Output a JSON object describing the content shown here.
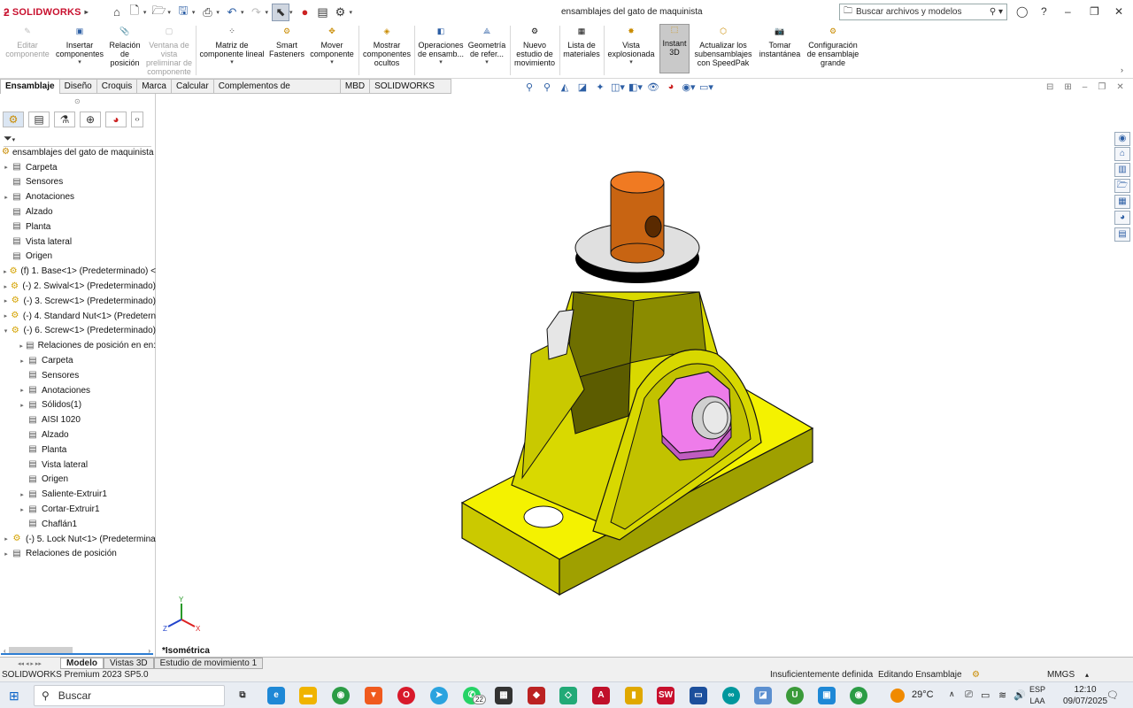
{
  "app": {
    "brand": "SOLIDWORKS",
    "document_title": "ensamblajes del gato de maquinista",
    "search_placeholder": "Buscar archivos y modelos"
  },
  "ribbon": [
    {
      "label": "Editar componente",
      "disabled": true
    },
    {
      "label": "Insertar componentes",
      "dropdown": true
    },
    {
      "label": "Relación de posición"
    },
    {
      "label": "Ventana de vista preliminar de componente",
      "disabled": true
    },
    {
      "label": "Matriz de componente lineal",
      "dropdown": true
    },
    {
      "label": "Smart Fasteners"
    },
    {
      "label": "Mover componente",
      "dropdown": true
    },
    {
      "label": "Mostrar componentes ocultos"
    },
    {
      "label": "Operaciones de ensamb...",
      "dropdown": true
    },
    {
      "label": "Geometría de refer...",
      "dropdown": true
    },
    {
      "label": "Nuevo estudio de movimiento"
    },
    {
      "label": "Lista de materiales"
    },
    {
      "label": "Vista explosionada",
      "dropdown": true
    },
    {
      "label": "Instant 3D",
      "active": true
    },
    {
      "label": "Actualizar los subensamblajes con SpeedPak"
    },
    {
      "label": "Tomar instantánea"
    },
    {
      "label": "Configuración de ensamblaje grande"
    }
  ],
  "tabs": [
    "Ensamblaje",
    "Diseño",
    "Croquis",
    "Marca",
    "Calcular",
    "Complementos de SOLIDWORKS",
    "MBD",
    "SOLIDWORKS CAM"
  ],
  "tree": [
    {
      "label": "ensamblajes del gato de maquinista (P",
      "indent": 0,
      "arrow": "",
      "icon": "asm"
    },
    {
      "label": "Carpeta",
      "indent": 0,
      "arrow": "▸",
      "icon": "doc"
    },
    {
      "label": "Sensores",
      "indent": 0,
      "arrow": "",
      "icon": "doc"
    },
    {
      "label": "Anotaciones",
      "indent": 0,
      "arrow": "▸",
      "icon": "doc"
    },
    {
      "label": "Alzado",
      "indent": 0,
      "arrow": "",
      "icon": "doc"
    },
    {
      "label": "Planta",
      "indent": 0,
      "arrow": "",
      "icon": "doc"
    },
    {
      "label": "Vista lateral",
      "indent": 0,
      "arrow": "",
      "icon": "doc"
    },
    {
      "label": "Origen",
      "indent": 0,
      "arrow": "",
      "icon": "doc"
    },
    {
      "label": "(f) 1. Base<1> (Predeterminado) <",
      "indent": 0,
      "arrow": "▸",
      "icon": "part"
    },
    {
      "label": "(-) 2. Swival<1> (Predeterminado)",
      "indent": 0,
      "arrow": "▸",
      "icon": "part"
    },
    {
      "label": "(-) 3. Screw<1> (Predeterminado)",
      "indent": 0,
      "arrow": "▸",
      "icon": "part"
    },
    {
      "label": "(-) 4. Standard Nut<1> (Predetern",
      "indent": 0,
      "arrow": "▸",
      "icon": "part"
    },
    {
      "label": "(-) 6. Screw<1> (Predeterminado)",
      "indent": 0,
      "arrow": "▾",
      "icon": "part"
    },
    {
      "label": "Relaciones de posición en en:",
      "indent": 1,
      "arrow": "▸",
      "icon": "doc"
    },
    {
      "label": "Carpeta",
      "indent": 1,
      "arrow": "▸",
      "icon": "doc"
    },
    {
      "label": "Sensores",
      "indent": 1,
      "arrow": "",
      "icon": "doc"
    },
    {
      "label": "Anotaciones",
      "indent": 1,
      "arrow": "▸",
      "icon": "doc"
    },
    {
      "label": "Sólidos(1)",
      "indent": 1,
      "arrow": "▸",
      "icon": "doc"
    },
    {
      "label": "AISI 1020",
      "indent": 1,
      "arrow": "",
      "icon": "doc"
    },
    {
      "label": "Alzado",
      "indent": 1,
      "arrow": "",
      "icon": "doc"
    },
    {
      "label": "Planta",
      "indent": 1,
      "arrow": "",
      "icon": "doc"
    },
    {
      "label": "Vista lateral",
      "indent": 1,
      "arrow": "",
      "icon": "doc"
    },
    {
      "label": "Origen",
      "indent": 1,
      "arrow": "",
      "icon": "doc"
    },
    {
      "label": "Saliente-Extruir1",
      "indent": 1,
      "arrow": "▸",
      "icon": "doc"
    },
    {
      "label": "Cortar-Extruir1",
      "indent": 1,
      "arrow": "▸",
      "icon": "doc"
    },
    {
      "label": "Chaflán1",
      "indent": 1,
      "arrow": "",
      "icon": "doc"
    },
    {
      "label": "(-) 5. Lock Nut<1> (Predetermina",
      "indent": 0,
      "arrow": "▸",
      "icon": "part"
    },
    {
      "label": "Relaciones de posición",
      "indent": 0,
      "arrow": "▸",
      "icon": "doc"
    }
  ],
  "view": {
    "orientation": "*Isométrica",
    "axis_x": "X",
    "axis_y": "Y",
    "axis_z": "Z"
  },
  "bottom_tabs": [
    "Modelo",
    "Vistas 3D",
    "Estudio de movimiento 1"
  ],
  "status": {
    "left": "SOLIDWORKS Premium 2023 SP5.0",
    "defined": "Insuficientemente definida",
    "mode": "Editando Ensamblaje",
    "units": "MMGS"
  },
  "taskbar": {
    "search": "Buscar",
    "temperature": "29°C",
    "lang1": "ESP",
    "lang2": "LAA",
    "time": "12:10",
    "date": "09/07/2025",
    "badge": "22"
  }
}
